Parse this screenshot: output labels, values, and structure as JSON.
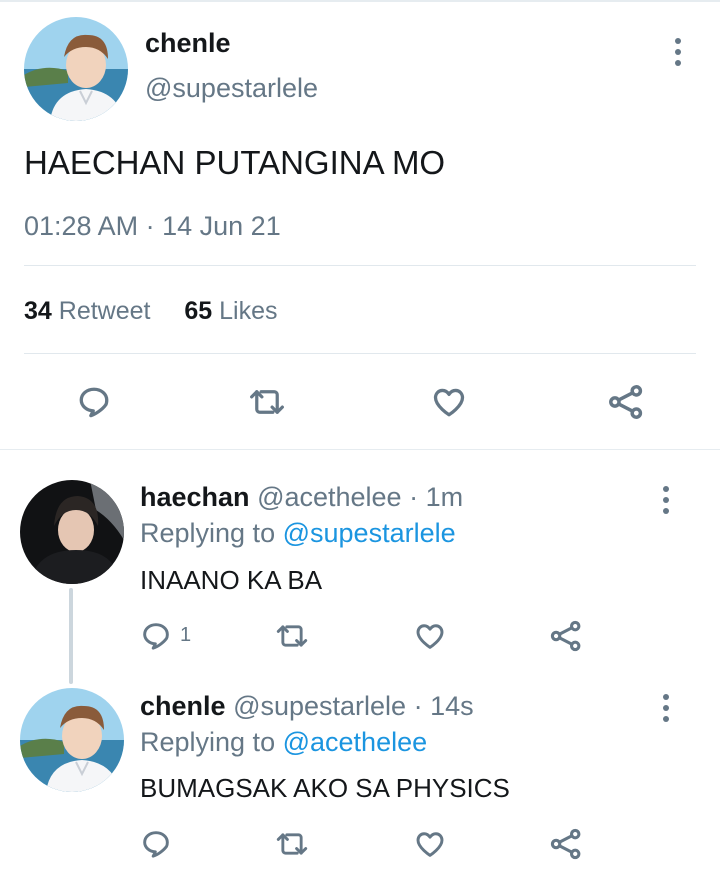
{
  "main_tweet": {
    "display_name": "chenle",
    "handle": "@supestarlele",
    "text": "HAECHAN PUTANGINA MO",
    "time": "01:28 AM",
    "separator": "·",
    "date": "14 Jun 21",
    "retweet_count": "34",
    "retweet_label": "Retweet",
    "like_count": "65",
    "like_label": "Likes"
  },
  "replies": [
    {
      "display_name": "haechan",
      "handle": "@acethelee",
      "time": "· 1m",
      "replying_prefix": "Replying to",
      "replying_to": "@supestarlele",
      "text": "INAANO KA BA",
      "reply_count": "1"
    },
    {
      "display_name": "chenle",
      "handle": "@supestarlele",
      "time": "· 14s",
      "replying_prefix": "Replying to",
      "replying_to": "@acethelee",
      "text": "BUMAGSAK AKO SA PHYSICS",
      "reply_count": ""
    }
  ],
  "icons": {
    "reply": "speech-bubble-icon",
    "retweet": "retweet-arrows-icon",
    "like": "heart-icon",
    "share": "share-nodes-icon",
    "more": "vertical-dots-icon"
  },
  "colors": {
    "text": "#14171a",
    "muted": "#657786",
    "link": "#1b95e0",
    "divider": "#e1e8ed",
    "thread_line": "#ccd6dd"
  }
}
